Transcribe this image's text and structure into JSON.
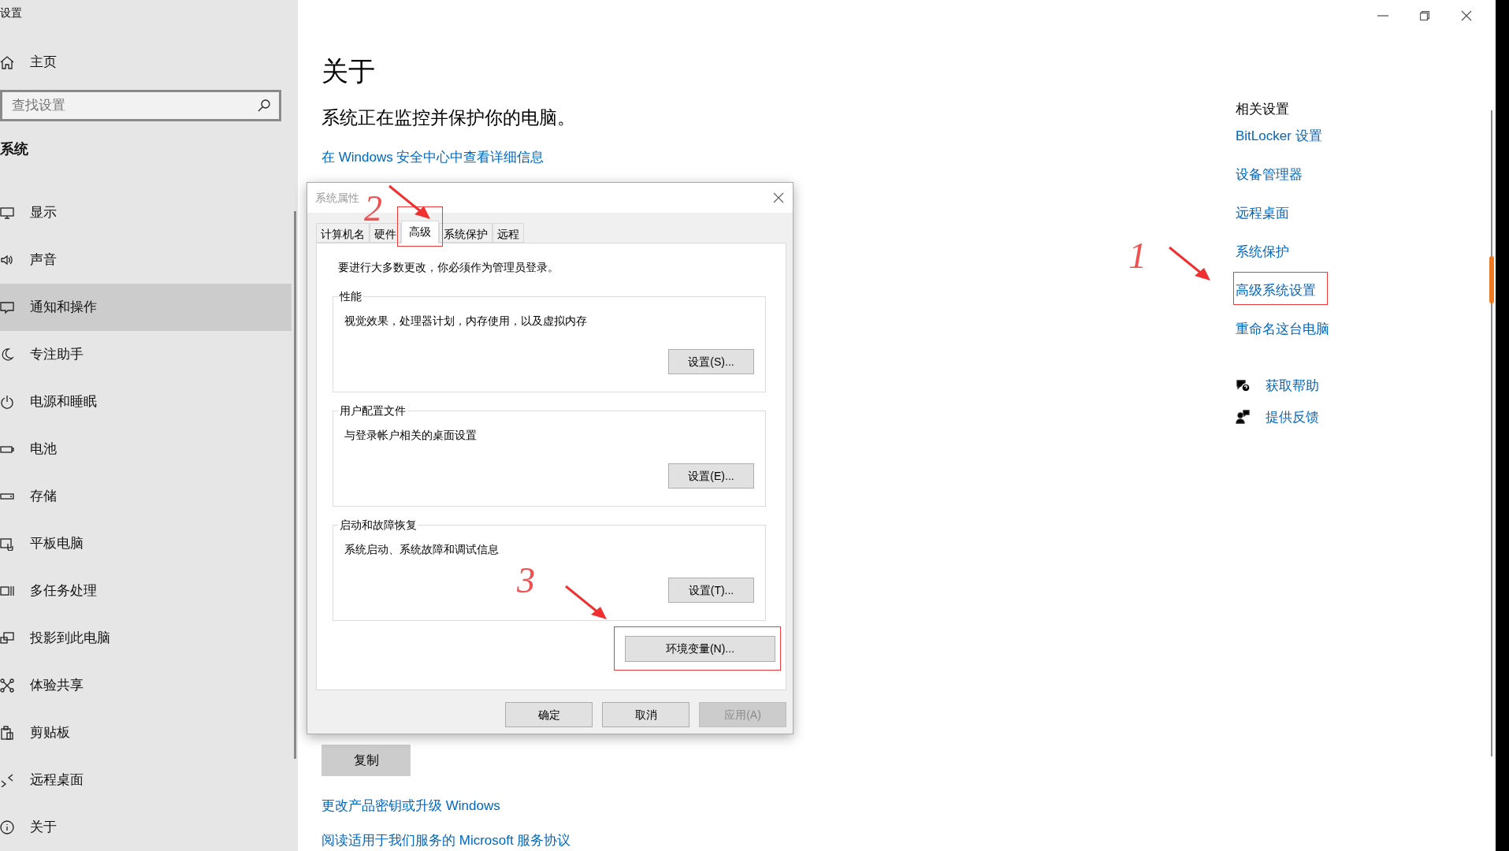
{
  "window": {
    "title": "设置"
  },
  "sidebar": {
    "home": "主页",
    "search": {
      "placeholder": "查找设置"
    },
    "section": "系统",
    "items": [
      {
        "label": "显示",
        "selected": false
      },
      {
        "label": "声音",
        "selected": false
      },
      {
        "label": "通知和操作",
        "selected": true
      },
      {
        "label": "专注助手",
        "selected": false
      },
      {
        "label": "电源和睡眠",
        "selected": false
      },
      {
        "label": "电池",
        "selected": false
      },
      {
        "label": "存储",
        "selected": false
      },
      {
        "label": "平板电脑",
        "selected": false
      },
      {
        "label": "多任务处理",
        "selected": false
      },
      {
        "label": "投影到此电脑",
        "selected": false
      },
      {
        "label": "体验共享",
        "selected": false
      },
      {
        "label": "剪贴板",
        "selected": false
      },
      {
        "label": "远程桌面",
        "selected": false
      },
      {
        "label": "关于",
        "selected": false
      }
    ]
  },
  "main": {
    "title": "关于",
    "status": "系统正在监控并保护你的电脑。",
    "security_link": "在 Windows 安全中心中查看详细信息",
    "copy_button": "复制",
    "links": [
      "更改产品密钥或升级 Windows",
      "阅读适用于我们服务的 Microsoft 服务协议"
    ]
  },
  "related": {
    "heading": "相关设置",
    "links": [
      "BitLocker 设置",
      "设备管理器",
      "远程桌面",
      "系统保护",
      "高级系统设置",
      "重命名这台电脑"
    ],
    "help": [
      "获取帮助",
      "提供反馈"
    ]
  },
  "dialog": {
    "title": "系统属性",
    "tabs": [
      {
        "label": "计算机名",
        "selected": false
      },
      {
        "label": "硬件",
        "selected": false
      },
      {
        "label": "高级",
        "selected": true
      },
      {
        "label": "系统保护",
        "selected": false
      },
      {
        "label": "远程",
        "selected": false
      }
    ],
    "notice": "要进行大多数更改，你必须作为管理员登录。",
    "groups": [
      {
        "legend": "性能",
        "description": "视觉效果，处理器计划，内存使用，以及虚拟内存",
        "button": "设置(S)..."
      },
      {
        "legend": "用户配置文件",
        "description": "与登录帐户相关的桌面设置",
        "button": "设置(E)..."
      },
      {
        "legend": "启动和故障恢复",
        "description": "系统启动、系统故障和调试信息",
        "button": "设置(T)..."
      }
    ],
    "env_button": "环境变量(N)...",
    "buttons": [
      {
        "label": "确定",
        "disabled": false
      },
      {
        "label": "取消",
        "disabled": false
      },
      {
        "label": "应用(A)",
        "disabled": true
      }
    ]
  },
  "annotations": [
    {
      "label": "1"
    },
    {
      "label": "2"
    },
    {
      "label": "3"
    }
  ]
}
